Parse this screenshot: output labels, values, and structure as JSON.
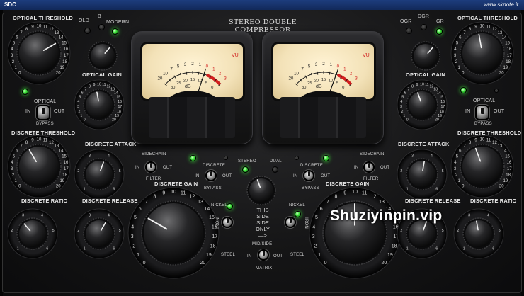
{
  "window": {
    "app_name": "SDC",
    "url": "www.sknote.it"
  },
  "plugin": {
    "title": "STEREO DOUBLE COMPRESSOR"
  },
  "left_channel": {
    "optical_threshold": "OPTICAL THRESHOLD",
    "mode_old": "OLD",
    "mode_b": "B",
    "mode_modern": "MODERN",
    "optical_gain": "OPTICAL GAIN",
    "optical": "OPTICAL",
    "in": "IN",
    "out": "OUT",
    "bypass": "BYPASS",
    "discrete_threshold": "DISCRETE THRESHOLD",
    "discrete_attack": "DISCRETE ATTACK",
    "sidechain": "SIDECHAIN",
    "filter": "FILTER",
    "discrete": "DISCRETE",
    "discrete_ratio": "DISCRETE RATIO",
    "discrete_release": "DISCRETE RELEASE",
    "discrete_gain": "DISCRETE GAIN",
    "nickel": "NICKEL",
    "steel": "STEEL",
    "iron": "IRON"
  },
  "right_channel": {
    "optical_threshold": "OPTICAL THRESHOLD",
    "mode_ogr": "OGR",
    "mode_dgr": "DGR",
    "mode_gr": "GR",
    "optical_gain": "OPTICAL GAIN",
    "optical": "OPTICAL",
    "in": "IN",
    "out": "OUT",
    "bypass": "BYPASS",
    "discrete_threshold": "DISCRETE THRESHOLD",
    "discrete_attack": "DISCRETE ATTACK",
    "sidechain": "SIDECHAIN",
    "filter": "FILTER",
    "discrete": "DISCRETE",
    "discrete_ratio": "DISCRETE RATIO",
    "discrete_release": "DISCRETE RELEASE",
    "discrete_gain": "DISCRETE GAIN",
    "nickel": "NICKEL",
    "steel": "STEEL",
    "iron": "IRON"
  },
  "center": {
    "stereo": "STEREO",
    "dual": "DUAL",
    "this_side_only": [
      "THIS",
      "SIDE",
      "SIDE",
      "ONLY",
      "—>"
    ],
    "mid_side": "MID/SIDE",
    "matrix": "MATRIX",
    "in": "IN",
    "out": "OUT"
  },
  "meters": {
    "unit": "dB",
    "vu": "VU",
    "scale_top": [
      "20",
      "10",
      "7",
      "5",
      "3",
      "2",
      "1",
      "0",
      "1",
      "2",
      "3"
    ],
    "scale_bottom": [
      "30",
      "25",
      "20",
      "15",
      "10",
      "5",
      "0"
    ]
  },
  "knob_scale": [
    "0",
    "1",
    "2",
    "3",
    "4",
    "5",
    "6",
    "7",
    "8",
    "9",
    "10",
    "11",
    "12",
    "13",
    "14",
    "15",
    "16",
    "17",
    "18",
    "19",
    "20"
  ],
  "small_scale": [
    "1",
    "2",
    "3",
    "4",
    "5",
    "6"
  ],
  "overlay": {
    "watermark": "Shuziyinpin.vip"
  },
  "colors": {
    "led_on": "#3ee33a",
    "titlebar": "#1d3d7d",
    "meter_face": "#f3e2b8",
    "meter_red": "#d21f1f"
  }
}
